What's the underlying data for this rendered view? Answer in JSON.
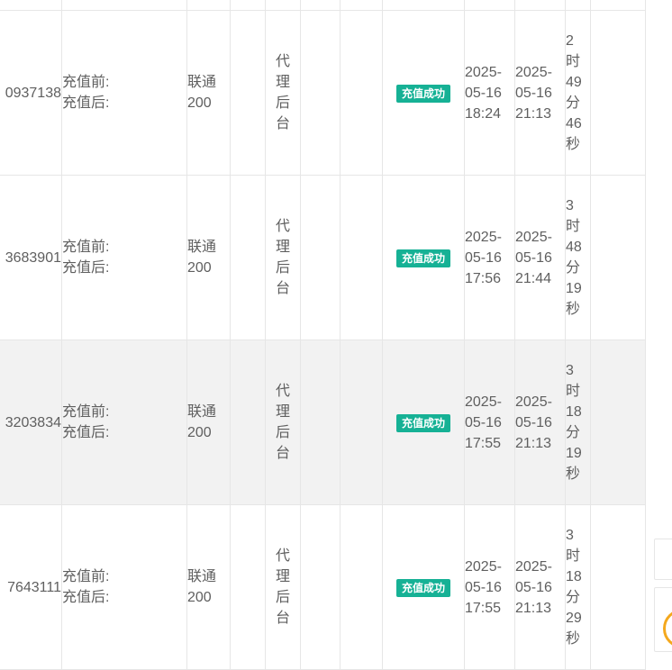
{
  "rows": [
    {
      "phone": "0937138",
      "before_label": "充值前:",
      "after_label": "充值后:",
      "product": "联通200",
      "source": "代理后台",
      "status": "充值成功",
      "start_time": "2025-05-16 18:24",
      "end_time": "2025-05-16 21:13",
      "duration": "2时49分46秒",
      "highlight": false
    },
    {
      "phone": "3683901",
      "before_label": "充值前:",
      "after_label": "充值后:",
      "product": "联通200",
      "source": "代理后台",
      "status": "充值成功",
      "start_time": "2025-05-16 17:56",
      "end_time": "2025-05-16 21:44",
      "duration": "3时48分19秒",
      "highlight": false
    },
    {
      "phone": "3203834",
      "before_label": "充值前:",
      "after_label": "充值后:",
      "product": "联通200",
      "source": "代理后台",
      "status": "充值成功",
      "start_time": "2025-05-16 17:55",
      "end_time": "2025-05-16 21:13",
      "duration": "3时18分19秒",
      "highlight": true
    },
    {
      "phone": "7643111",
      "before_label": "充值前:",
      "after_label": "充值后:",
      "product": "联通200",
      "source": "代理后台",
      "status": "充值成功",
      "start_time": "2025-05-16 17:55",
      "end_time": "2025-05-16 21:13",
      "duration": "3时18分29秒",
      "highlight": false
    }
  ],
  "colors": {
    "status_success": "#16b195",
    "row_highlight": "#f2f2f2",
    "border": "#e6e6e6",
    "float_ring": "#f4a81d"
  },
  "icons": {
    "float_button": "circle-ring-icon"
  }
}
